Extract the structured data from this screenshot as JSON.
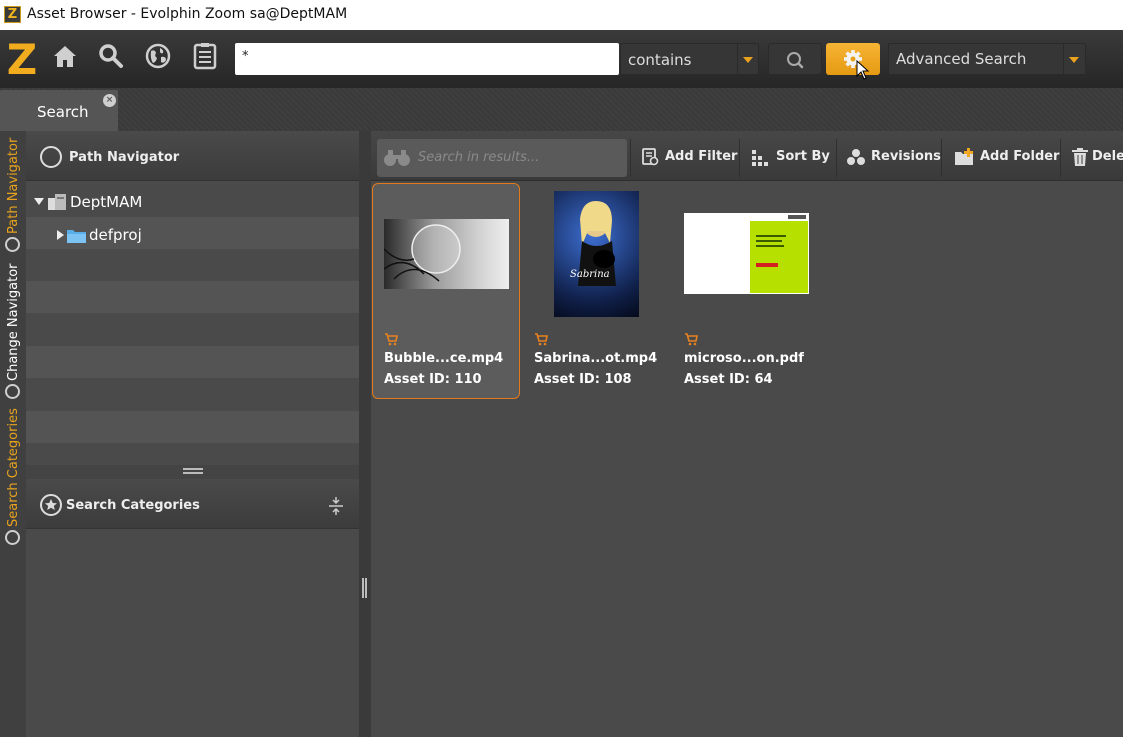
{
  "window": {
    "title": "Asset Browser - Evolphin Zoom sa@DeptMAM",
    "app_icon_letter": "Z"
  },
  "toolbar": {
    "logo": "Z",
    "icons": [
      "home-icon",
      "search-icon",
      "globe-icon",
      "clipboard-icon"
    ],
    "search_value": "*",
    "match_mode": "contains",
    "advanced_search_label": "Advanced Search",
    "accent_color": "#f0a824"
  },
  "tabs": [
    {
      "label": "Search",
      "active": true
    }
  ],
  "side_tabs": [
    "Path Navigator",
    "Change Navigator",
    "Search Categories"
  ],
  "path_navigator": {
    "title": "Path Navigator",
    "tree": [
      {
        "label": "DeptMAM",
        "expanded": true
      },
      {
        "label": "defproj",
        "expanded": false
      }
    ]
  },
  "search_categories": {
    "title": "Search Categories"
  },
  "results_toolbar": {
    "filter_placeholder": "Search in results...",
    "buttons": [
      "Add Filter",
      "Sort By",
      "Revisions",
      "Add Folder",
      "Delete"
    ]
  },
  "assets": [
    {
      "name": "Bubble...ce.mp4",
      "id": "Asset ID: 110",
      "selected": true
    },
    {
      "name": "Sabrina...ot.mp4",
      "id": "Asset ID: 108",
      "selected": false,
      "thumb_caption": "Sabrina"
    },
    {
      "name": "microso...on.pdf",
      "id": "Asset ID: 64",
      "selected": false
    }
  ]
}
